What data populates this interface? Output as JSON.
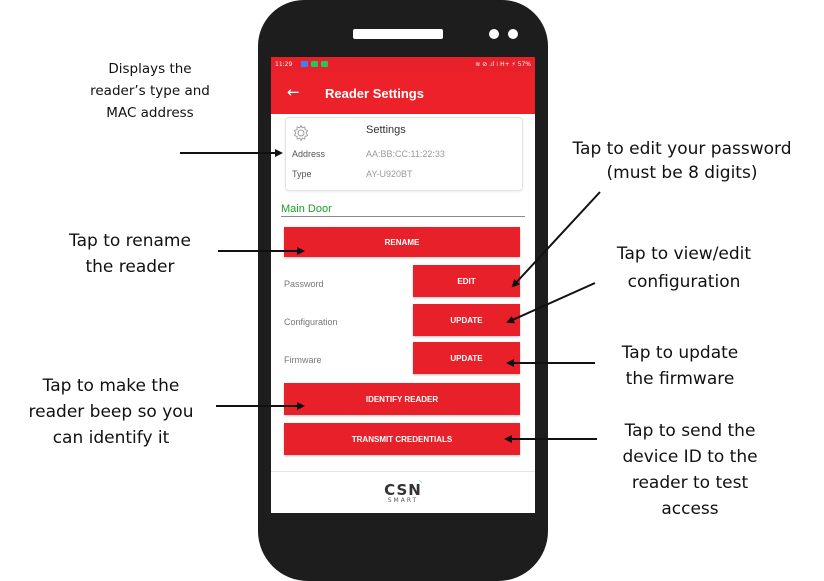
{
  "status_bar": {
    "time": "11:29",
    "right": "≋ ⊘ .ıl ⁞ H+ ⚡ 57%"
  },
  "app_bar": {
    "title": "Reader Settings",
    "back_icon": "arrow-left-icon"
  },
  "settings_card": {
    "title": "Settings",
    "icon": "gear-icon",
    "address_label": "Address",
    "address_value": "AA:BB:CC:11:22:33",
    "type_label": "Type",
    "type_value": "AY-U920BT"
  },
  "reader_name": "Main Door",
  "buttons": {
    "rename": "RENAME",
    "password_edit": "EDIT",
    "configuration_update": "UPDATE",
    "firmware_update": "UPDATE",
    "identify": "IDENTIFY READER",
    "transmit": "TRANSMIT CREDENTIALS"
  },
  "rows": {
    "password": "Password",
    "configuration": "Configuration",
    "firmware": "Firmware"
  },
  "logo": {
    "main": "CSN",
    "sub": "SMART"
  },
  "annotations": {
    "type_mac": [
      "Displays the",
      "reader’s type and",
      "MAC address"
    ],
    "password": [
      "Tap to edit your password",
      "(must be 8 digits)"
    ],
    "rename": [
      "Tap to rename",
      "the reader"
    ],
    "configuration": [
      "Tap to view/edit",
      "configuration"
    ],
    "firmware": [
      "Tap to update",
      "the firmware"
    ],
    "identify": [
      "Tap to make the",
      "reader beep so you",
      "can identify it"
    ],
    "transmit": [
      "Tap to send the",
      "device ID to the",
      "reader to test",
      "access"
    ]
  },
  "colors": {
    "accent": "#e82029",
    "name_green": "#18a127",
    "phone_body": "#1d1d1d"
  }
}
